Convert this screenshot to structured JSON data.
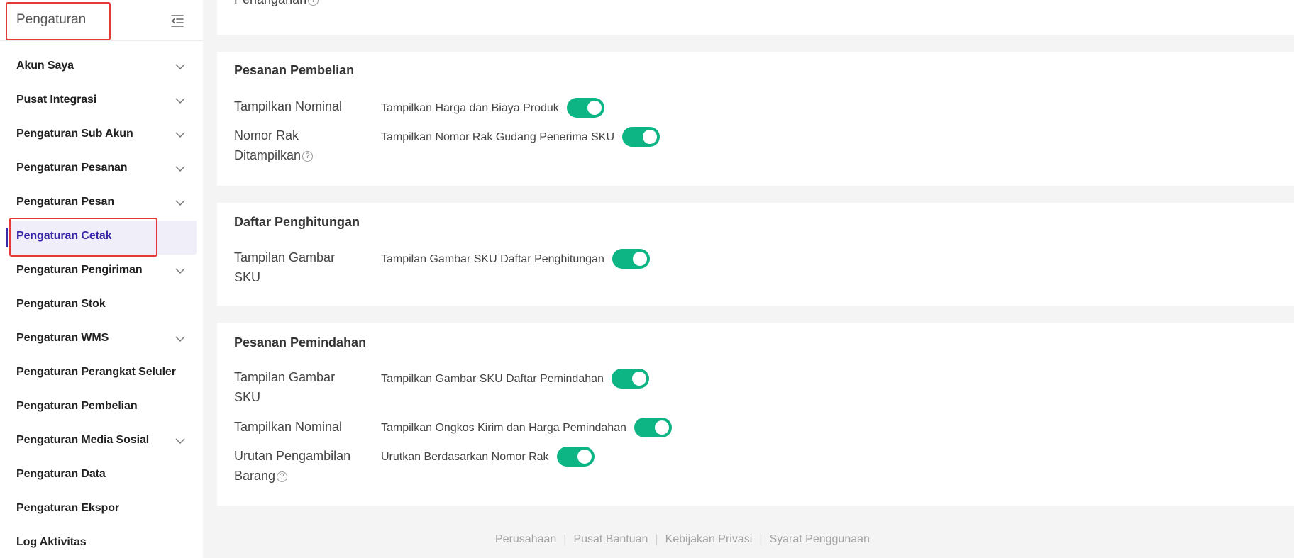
{
  "sidebar": {
    "title": "Pengaturan",
    "items": [
      {
        "label": "Akun Saya",
        "chevron": true
      },
      {
        "label": "Pusat Integrasi",
        "chevron": true
      },
      {
        "label": "Pengaturan Sub Akun",
        "chevron": true
      },
      {
        "label": "Pengaturan Pesanan",
        "chevron": true
      },
      {
        "label": "Pengaturan Pesan",
        "chevron": true
      },
      {
        "label": "Pengaturan Cetak",
        "chevron": false,
        "active": true
      },
      {
        "label": "Pengaturan Pengiriman",
        "chevron": true
      },
      {
        "label": "Pengaturan Stok",
        "chevron": false
      },
      {
        "label": "Pengaturan WMS",
        "chevron": true
      },
      {
        "label": "Pengaturan Perangkat Seluler",
        "chevron": false
      },
      {
        "label": "Pengaturan Pembelian",
        "chevron": false
      },
      {
        "label": "Pengaturan Media Sosial",
        "chevron": true
      },
      {
        "label": "Pengaturan Data",
        "chevron": false
      },
      {
        "label": "Pengaturan Ekspor",
        "chevron": false
      },
      {
        "label": "Log Aktivitas",
        "chevron": false
      }
    ]
  },
  "main": {
    "top_partial_label": "Penanganan",
    "sections": {
      "purchase": {
        "title": "Pesanan Pembelian",
        "rows": [
          {
            "label": "Tampilkan Nominal",
            "option": "Tampilkan Harga dan Biaya Produk",
            "enabled": true
          },
          {
            "label_line1": "Nomor Rak",
            "label_line2": "Ditampilkan",
            "help": "?",
            "option": "Tampilkan Nomor Rak Gudang Penerima SKU",
            "enabled": true
          }
        ]
      },
      "count": {
        "title": "Daftar Penghitungan",
        "rows": [
          {
            "label_line1": "Tampilan Gambar",
            "label_line2": "SKU",
            "option": "Tampilan Gambar SKU Daftar Penghitungan",
            "enabled": true
          }
        ]
      },
      "transfer": {
        "title": "Pesanan Pemindahan",
        "rows": [
          {
            "label_line1": "Tampilan Gambar",
            "label_line2": "SKU",
            "option": "Tampilkan Gambar SKU Daftar Pemindahan",
            "enabled": true
          },
          {
            "label": "Tampilkan Nominal",
            "option": "Tampilkan Ongkos Kirim dan Harga Pemindahan",
            "enabled": true
          },
          {
            "label_line1": "Urutan Pengambilan",
            "label_line2": "Barang",
            "help": "?",
            "option": "Urutkan Berdasarkan Nomor Rak",
            "enabled": true
          }
        ]
      }
    }
  },
  "footer": {
    "links": [
      "Perusahaan",
      "Pusat Bantuan",
      "Kebijakan Privasi",
      "Syarat Penggunaan"
    ],
    "separator": "|"
  },
  "colors": {
    "accent": "#3826a8",
    "toggle_on": "#0db585",
    "highlight": "#e53935"
  },
  "icons": {
    "collapse": "menu-collapse-icon",
    "chevron": "chevron-down-icon",
    "help": "help-circle-icon"
  }
}
